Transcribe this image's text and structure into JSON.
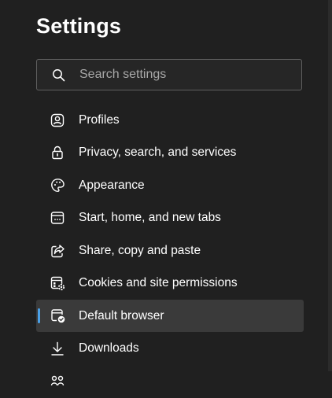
{
  "page_title": "Settings",
  "search": {
    "placeholder": "Search settings",
    "icon": "search-icon"
  },
  "sidebar": {
    "items": [
      {
        "label": "Profiles",
        "icon": "profile-icon"
      },
      {
        "label": "Privacy, search, and services",
        "icon": "lock-icon"
      },
      {
        "label": "Appearance",
        "icon": "palette-icon"
      },
      {
        "label": "Start, home, and new tabs",
        "icon": "start-tabs-icon"
      },
      {
        "label": "Share, copy and paste",
        "icon": "share-icon"
      },
      {
        "label": "Cookies and site permissions",
        "icon": "cookies-permissions-icon"
      },
      {
        "label": "Default browser",
        "icon": "default-browser-icon",
        "selected": true
      },
      {
        "label": "Downloads",
        "icon": "download-icon"
      },
      {
        "label": "",
        "icon": "family-icon"
      }
    ]
  },
  "colors": {
    "background": "#202020",
    "selected_item": "#3a3a3a",
    "accent": "#4aa0e6",
    "search_border": "#5f5f5f"
  }
}
